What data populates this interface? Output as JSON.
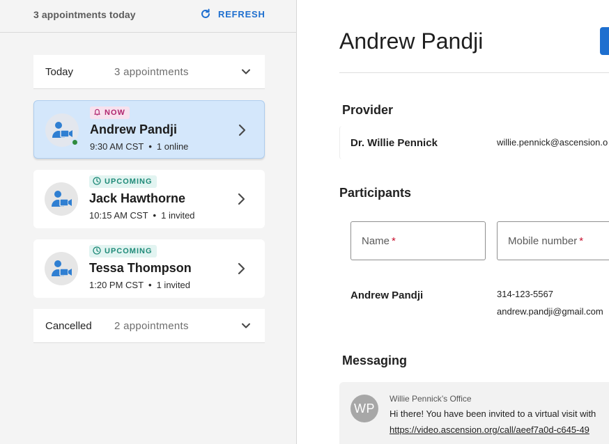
{
  "left_header": {
    "summary": "3 appointments today",
    "refresh_label": "REFRESH"
  },
  "sections": {
    "today": {
      "title": "Today",
      "count": "3 appointments"
    },
    "cancelled": {
      "title": "Cancelled",
      "count": "2 appointments"
    }
  },
  "appointments": [
    {
      "badge": "NOW",
      "name": "Andrew Pandji",
      "time": "9:30 AM CST",
      "participants": "1 online"
    },
    {
      "badge": "UPCOMING",
      "name": "Jack Hawthorne",
      "time": "10:15 AM CST",
      "participants": "1 invited"
    },
    {
      "badge": "UPCOMING",
      "name": "Tessa Thompson",
      "time": "1:20 PM CST",
      "participants": "1 invited"
    }
  ],
  "detail": {
    "title": "Andrew Pandji",
    "provider_heading": "Provider",
    "provider": {
      "name": "Dr. Willie Pennick",
      "email": "willie.pennick@ascension.o"
    },
    "participants_heading": "Participants",
    "fields": {
      "name_label": "Name",
      "mobile_label": "Mobile number",
      "required_mark": "*"
    },
    "participant": {
      "name": "Andrew Pandji",
      "phone": "314-123-5567",
      "email": "andrew.pandji@gmail.com"
    },
    "messaging_heading": "Messaging",
    "message": {
      "initials": "WP",
      "from": "Willie Pennick’s Office",
      "text": "Hi there! You have been invited to a virtual visit with",
      "link": "https://video.ascension.org/call/aeef7a0d-c645-49"
    }
  },
  "colors": {
    "accent": "#1e6fcf",
    "active_card": "#d4e7fb",
    "now_badge_text": "#b0266e",
    "now_badge_bg": "#f7e1ee",
    "upcoming_badge_text": "#1e8a78",
    "upcoming_badge_bg": "#e2f4f1",
    "online": "#2e8b3e",
    "required": "#c8102e"
  },
  "icons": {
    "refresh": "refresh-icon",
    "expand": "chevron-down-icon",
    "open": "chevron-right-icon",
    "now": "bell-icon",
    "upcoming": "clock-icon",
    "appointment": "video-person-icon"
  }
}
